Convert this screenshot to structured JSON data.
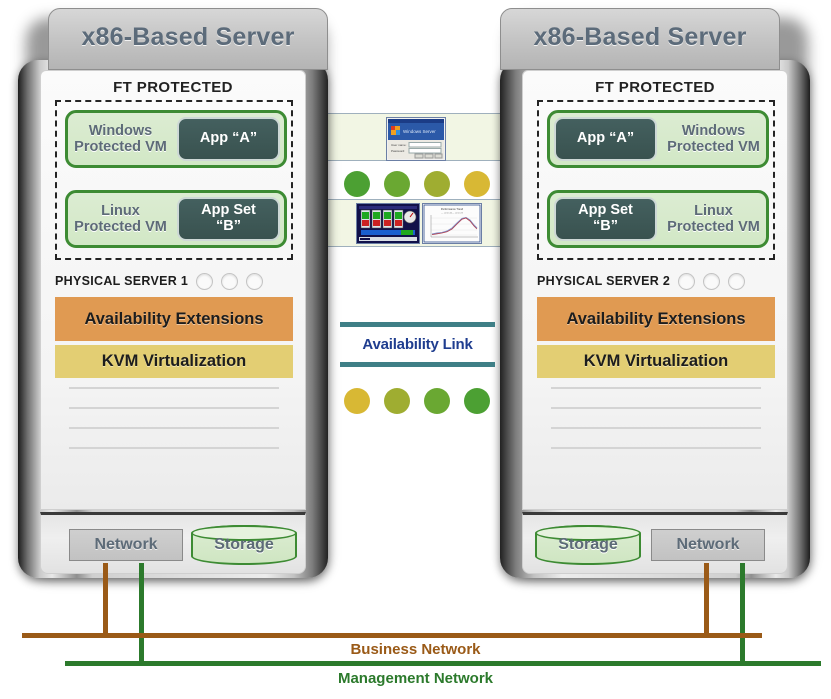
{
  "servers": [
    {
      "id": "server-1",
      "title": "x86-Based Server",
      "ft_label": "FT PROTECTED",
      "physical_label": "PHYSICAL  SERVER 1",
      "bay_count": 3,
      "vms": [
        {
          "name": "Windows\nProtected VM",
          "app": "App “A”"
        },
        {
          "name": "Linux\nProtected VM",
          "app": "App Set\n“B”"
        }
      ],
      "bands": [
        {
          "label": "Availability Extensions",
          "color": "#e09a52"
        },
        {
          "label": "KVM Virtualization",
          "color": "#e3ce73"
        }
      ],
      "network_label": "Network",
      "storage_label": "Storage"
    },
    {
      "id": "server-2",
      "title": "x86-Based Server",
      "ft_label": "FT PROTECTED",
      "physical_label": "PHYSICAL  SERVER 2",
      "bay_count": 3,
      "vms": [
        {
          "name": "Windows\nProtected VM",
          "app": "App “A”"
        },
        {
          "name": "Linux\nProtected VM",
          "app": "App Set\n“B”"
        }
      ],
      "bands": [
        {
          "label": "Availability Extensions",
          "color": "#e09a52"
        },
        {
          "label": "KVM Virtualization",
          "color": "#e3ce73"
        }
      ],
      "network_label": "Network",
      "storage_label": "Storage"
    }
  ],
  "center": {
    "availability_link_label": "Availability Link",
    "link_bar_color": "#3e7f86",
    "link_text_color": "#1f3d8f",
    "dots_top": [
      "#4ca033",
      "#6aa832",
      "#9fad31",
      "#d8b834"
    ],
    "dots_bottom": [
      "#d8b834",
      "#9fad31",
      "#6aa832",
      "#4ca033"
    ],
    "band_fill": "#f2f6e4",
    "band_border": "#9fb0bd",
    "thumbnails": [
      {
        "name": "windows-login-dialog-thumbnail",
        "row": 1
      },
      {
        "name": "scada-panel-thumbnail",
        "row": 2
      },
      {
        "name": "line-chart-thumbnail",
        "row": 2
      }
    ]
  },
  "networks": [
    {
      "name": "Business Network",
      "color": "#9a5a17"
    },
    {
      "name": "Management Network",
      "color": "#2c7a2c"
    }
  ]
}
